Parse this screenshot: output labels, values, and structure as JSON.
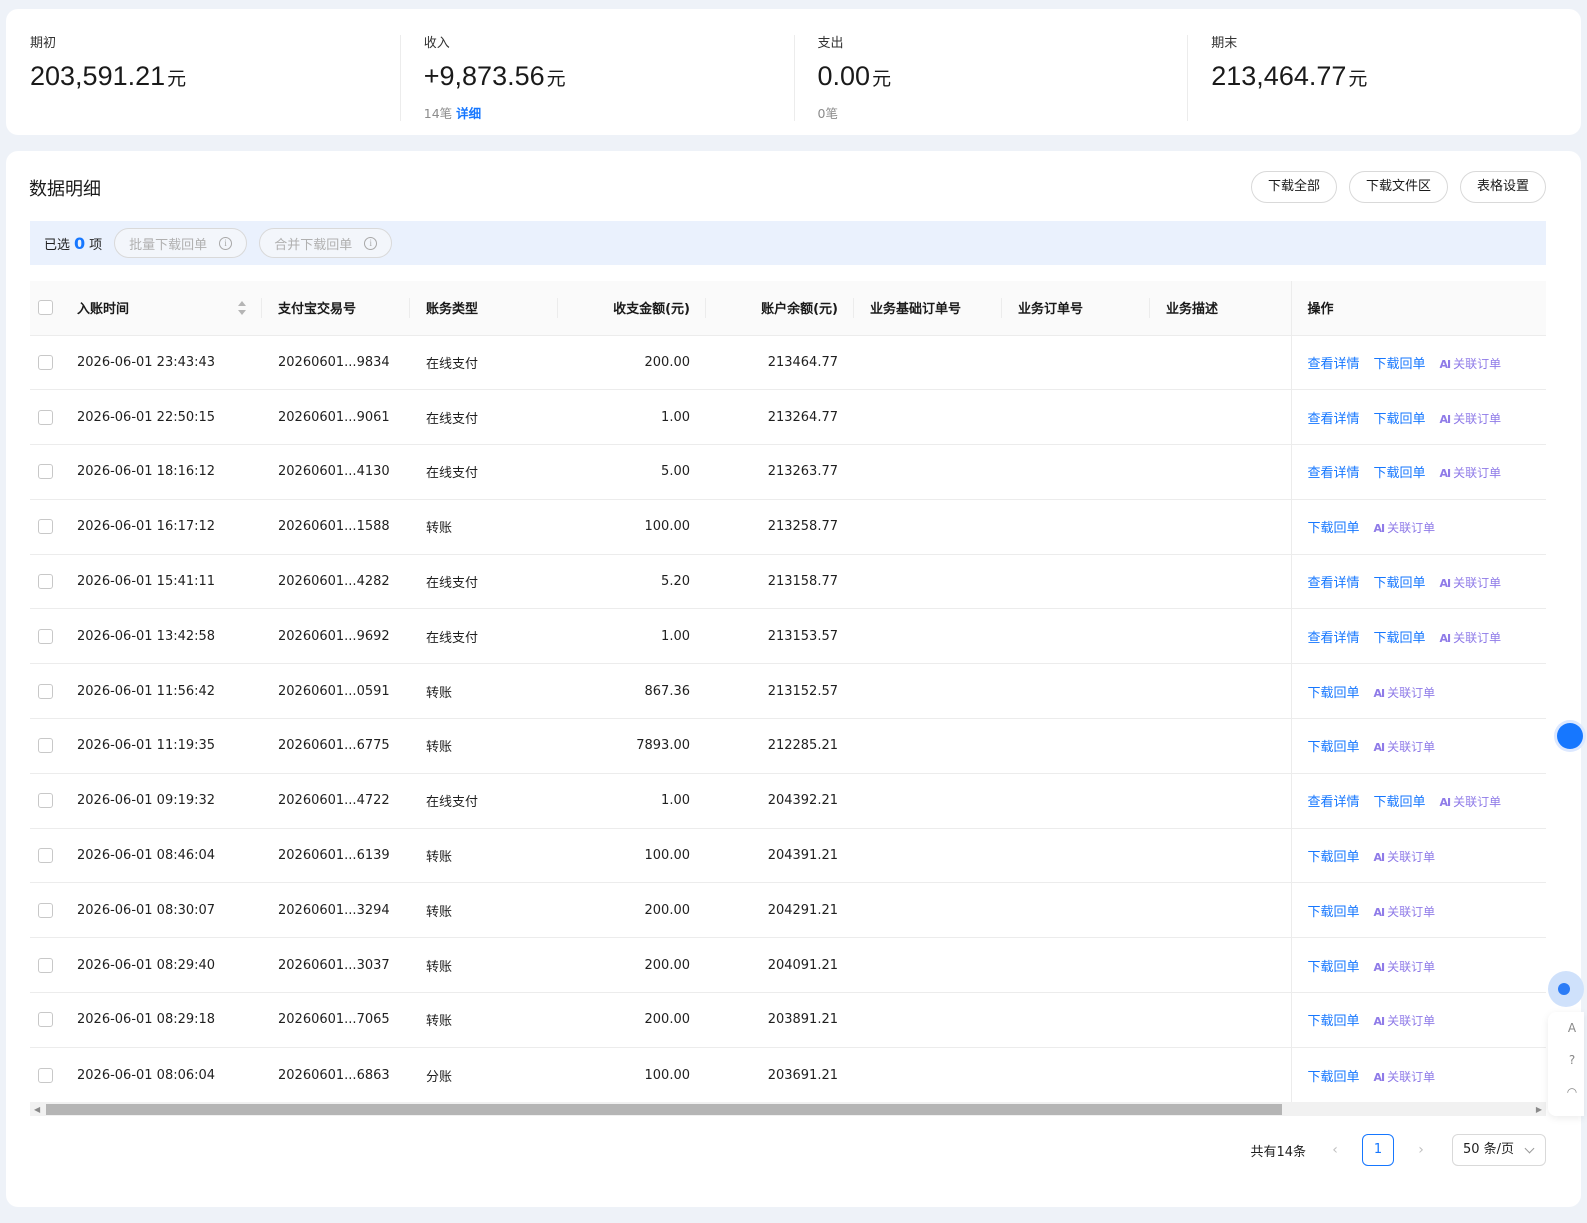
{
  "summary": {
    "opening": {
      "label": "期初",
      "value": "203,591.21",
      "unit": "元"
    },
    "income": {
      "label": "收入",
      "value": "+9,873.56",
      "unit": "元",
      "count": "14笔",
      "detail_link": "详细"
    },
    "expense": {
      "label": "支出",
      "value": "0.00",
      "unit": "元",
      "count": "0笔"
    },
    "closing": {
      "label": "期末",
      "value": "213,464.77",
      "unit": "元"
    }
  },
  "panel": {
    "title": "数据明细",
    "buttons": {
      "download_all": "下载全部",
      "download_area": "下载文件区",
      "table_settings": "表格设置"
    }
  },
  "selection": {
    "prefix": "已选",
    "count": "0",
    "suffix": "项",
    "batch_download": "批量下载回单",
    "merge_download": "合并下载回单"
  },
  "table": {
    "columns": {
      "time": "入账时间",
      "trade_no": "支付宝交易号",
      "type": "账务类型",
      "amount": "收支金额(元)",
      "balance": "账户余额(元)",
      "base_order": "业务基础订单号",
      "order": "业务订单号",
      "desc": "业务描述",
      "ops": "操作"
    },
    "actions": {
      "view": "查看详情",
      "download": "下载回单",
      "relate_icon": "AI",
      "relate": "关联订单"
    },
    "rows": [
      {
        "time": "2026-06-01 23:43:43",
        "trade_no": "20260601...9834",
        "type": "在线支付",
        "amount": "200.00",
        "balance": "213464.77",
        "view": true
      },
      {
        "time": "2026-06-01 22:50:15",
        "trade_no": "20260601...9061",
        "type": "在线支付",
        "amount": "1.00",
        "balance": "213264.77",
        "view": true
      },
      {
        "time": "2026-06-01 18:16:12",
        "trade_no": "20260601...4130",
        "type": "在线支付",
        "amount": "5.00",
        "balance": "213263.77",
        "view": true
      },
      {
        "time": "2026-06-01 16:17:12",
        "trade_no": "20260601...1588",
        "type": "转账",
        "amount": "100.00",
        "balance": "213258.77",
        "view": false
      },
      {
        "time": "2026-06-01 15:41:11",
        "trade_no": "20260601...4282",
        "type": "在线支付",
        "amount": "5.20",
        "balance": "213158.77",
        "view": true
      },
      {
        "time": "2026-06-01 13:42:58",
        "trade_no": "20260601...9692",
        "type": "在线支付",
        "amount": "1.00",
        "balance": "213153.57",
        "view": true
      },
      {
        "time": "2026-06-01 11:56:42",
        "trade_no": "20260601...0591",
        "type": "转账",
        "amount": "867.36",
        "balance": "213152.57",
        "view": false
      },
      {
        "time": "2026-06-01 11:19:35",
        "trade_no": "20260601...6775",
        "type": "转账",
        "amount": "7893.00",
        "balance": "212285.21",
        "view": false
      },
      {
        "time": "2026-06-01 09:19:32",
        "trade_no": "20260601...4722",
        "type": "在线支付",
        "amount": "1.00",
        "balance": "204392.21",
        "view": true
      },
      {
        "time": "2026-06-01 08:46:04",
        "trade_no": "20260601...6139",
        "type": "转账",
        "amount": "100.00",
        "balance": "204391.21",
        "view": false
      },
      {
        "time": "2026-06-01 08:30:07",
        "trade_no": "20260601...3294",
        "type": "转账",
        "amount": "200.00",
        "balance": "204291.21",
        "view": false
      },
      {
        "time": "2026-06-01 08:29:40",
        "trade_no": "20260601...3037",
        "type": "转账",
        "amount": "200.00",
        "balance": "204091.21",
        "view": false
      },
      {
        "time": "2026-06-01 08:29:18",
        "trade_no": "20260601...7065",
        "type": "转账",
        "amount": "200.00",
        "balance": "203891.21",
        "view": false
      },
      {
        "time": "2026-06-01 08:06:04",
        "trade_no": "20260601...6863",
        "type": "分账",
        "amount": "100.00",
        "balance": "203691.21",
        "view": false
      }
    ]
  },
  "pagination": {
    "total": "共有14条",
    "current_page": "1",
    "prev": "‹",
    "next": "›",
    "page_size": "50 条/页"
  },
  "colors": {
    "accent": "#1677ff",
    "relate": "#8f7be8",
    "background": "#eef2f8"
  }
}
